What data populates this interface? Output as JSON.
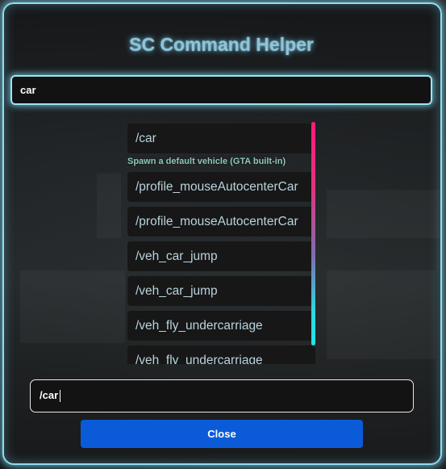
{
  "title": "SC Command Helper",
  "search": {
    "value": "car"
  },
  "results": {
    "items": [
      {
        "label": "/car"
      },
      {
        "label": "/profile_mouseAutocenterCar"
      },
      {
        "label": "/profile_mouseAutocenterCar"
      },
      {
        "label": "/veh_car_jump"
      },
      {
        "label": "/veh_car_jump"
      },
      {
        "label": "/veh_fly_undercarriage"
      },
      {
        "label": "/veh_fly_undercarriage"
      }
    ],
    "selected_description": "Spawn a default vehicle (GTA built-in)"
  },
  "command_input": {
    "value": "/car"
  },
  "close_button": {
    "label": "Close"
  },
  "colors": {
    "accent_glow": "#8fdcef",
    "title": "#8fc3d8",
    "close_button": "#0b5bd8",
    "scrollbar_top": "#ff1a7a",
    "scrollbar_bottom": "#1ee6ea"
  }
}
